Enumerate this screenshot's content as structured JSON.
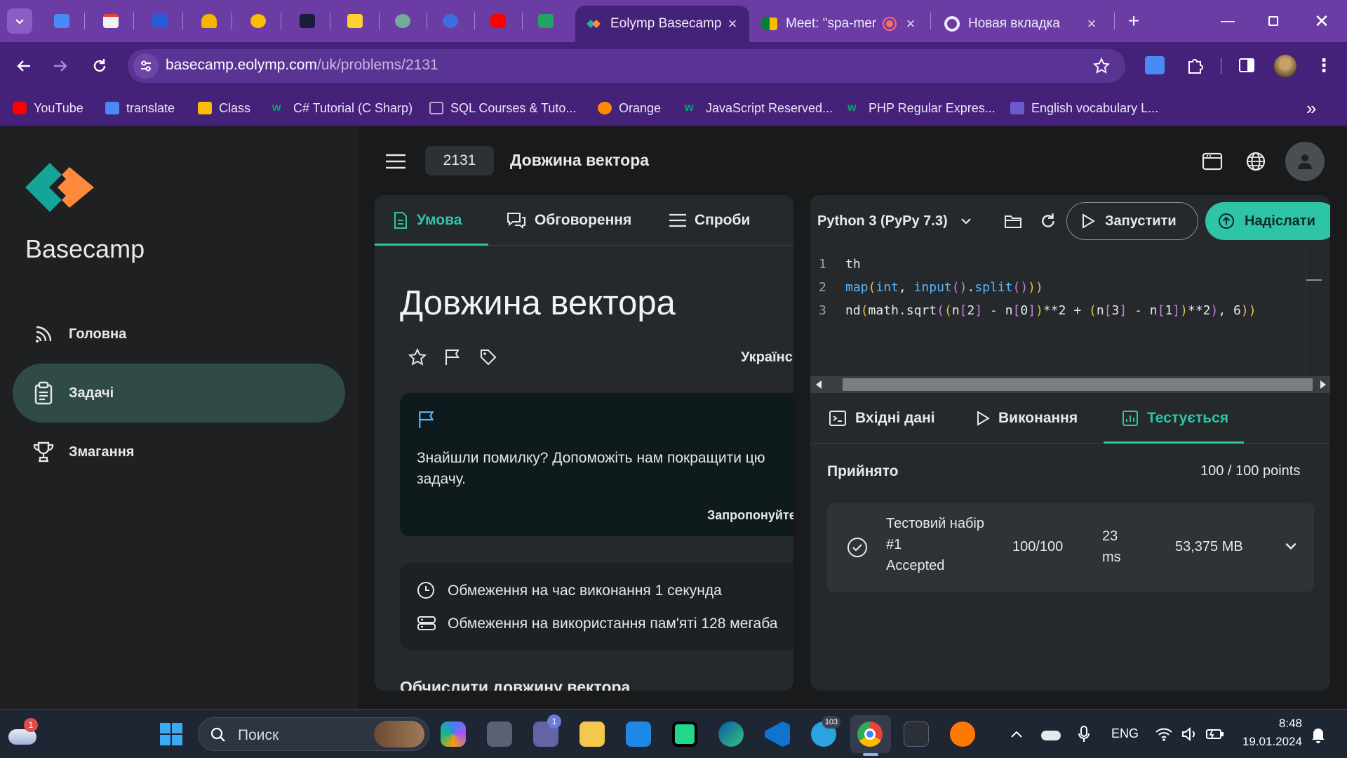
{
  "browser": {
    "tabs": [
      {
        "title": "Eolymp Basecamp",
        "active": true
      },
      {
        "title": "Meet: \"spa-mer",
        "active": false
      },
      {
        "title": "Новая вкладка",
        "active": false
      }
    ],
    "url_host": "basecamp.eolymp.com",
    "url_path": "/uk/problems/2131",
    "bookmarks": [
      "YouTube",
      "translate",
      "Class",
      "C# Tutorial (C Sharp)",
      "SQL Courses & Tuto...",
      "Orange",
      "JavaScript Reserved...",
      "PHP Regular Expres...",
      "English vocabulary L..."
    ],
    "bookmarks_more": "»",
    "new_tab": "+"
  },
  "sidebar": {
    "brand": "Basecamp",
    "items": [
      {
        "label": "Головна",
        "icon": "feed-icon"
      },
      {
        "label": "Задачі",
        "icon": "clipboard-icon",
        "active": true
      },
      {
        "label": "Змагання",
        "icon": "trophy-icon"
      }
    ]
  },
  "header": {
    "problem_id": "2131",
    "title": "Довжина вектора"
  },
  "problem": {
    "tabs": [
      "Умова",
      "Обговорення",
      "Спроби"
    ],
    "title": "Довжина вектора",
    "language": "Українс",
    "notice_text": "Знайшли помилку? Допоможіть нам покращити цю задачу.",
    "notice_link": "Запропонуйте",
    "limit_time": "Обмеження на час виконання 1 секунда",
    "limit_memory": "Обмеження на використання пам'яті 128 мегаба",
    "statement": "Обчислити довжину вектора"
  },
  "editor": {
    "language": "Python 3 (PyPy 7.3)",
    "run_label": "Запустити",
    "submit_label": "Надіслати",
    "lines": [
      {
        "n": "1",
        "text": "th"
      },
      {
        "n": "2",
        "text": "map(int, input().split()))"
      },
      {
        "n": "3",
        "text": "nd(math.sqrt((n[2] - n[0])**2 + (n[3] - n[1])**2), 6))"
      }
    ]
  },
  "results": {
    "tabs": [
      "Вхідні дані",
      "Виконання",
      "Тестується"
    ],
    "status": "Прийнято",
    "points": "100 / 100 points",
    "test": {
      "name_line1": "Тестовий набір",
      "name_line2": "#1",
      "verdict": "Accepted",
      "score": "100/100",
      "time_line1": "23",
      "time_line2": "ms",
      "memory": "53,375 MB"
    }
  },
  "taskbar": {
    "search_placeholder": "Поиск",
    "weather_badge": "1",
    "teams_badge": "1",
    "telegram_badge": "103",
    "lang": "ENG",
    "time": "8:48",
    "date": "19.01.2024"
  },
  "colors": {
    "accent": "#2ec4a6",
    "chrome": "#6a3ca4",
    "chrome_dark": "#44227a"
  }
}
